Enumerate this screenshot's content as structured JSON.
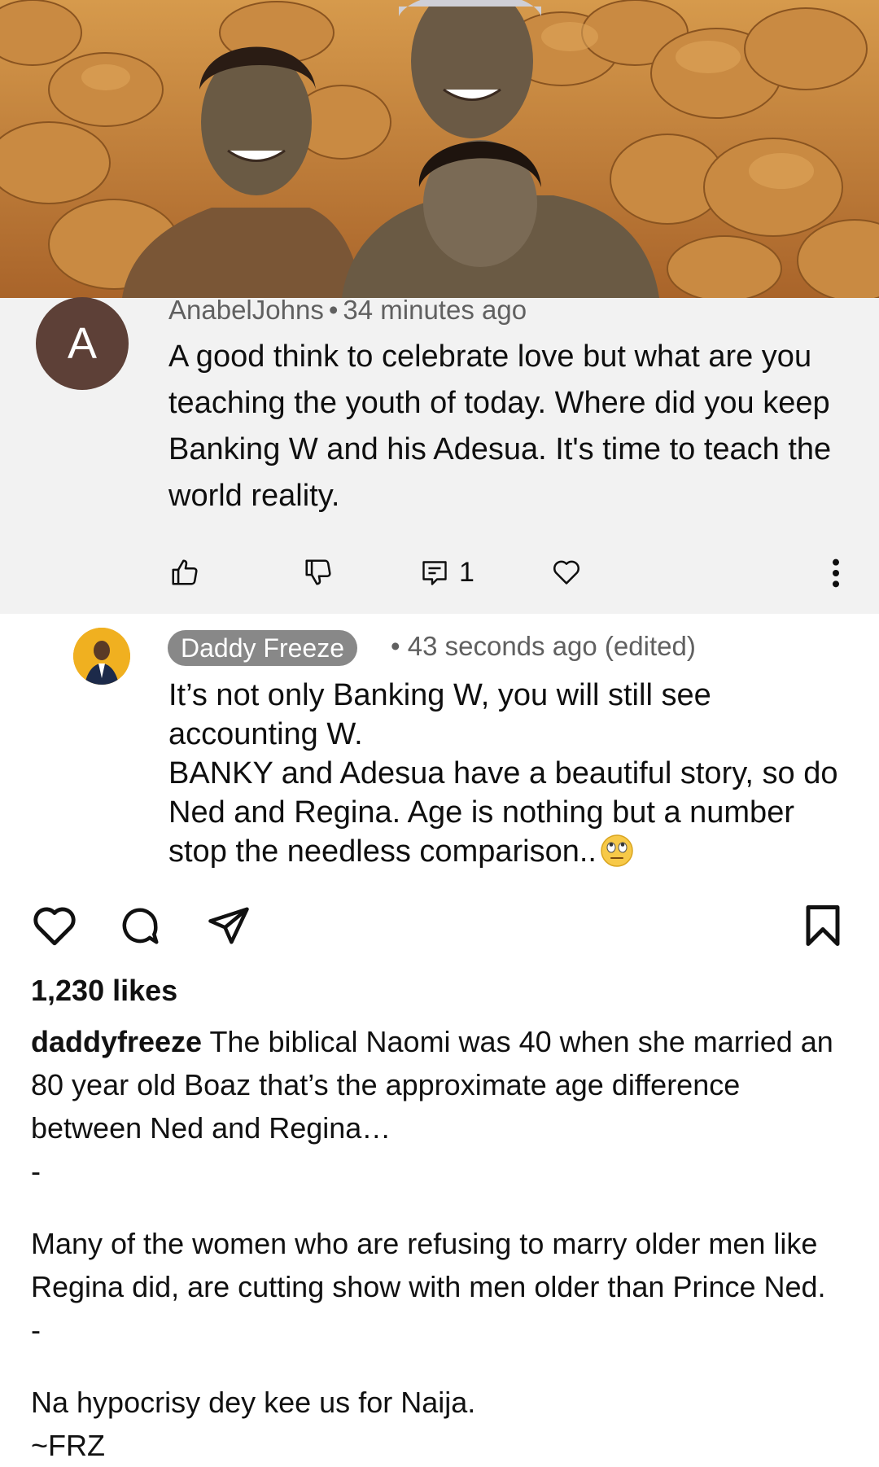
{
  "comment1": {
    "avatar_letter": "A",
    "avatar_color": "#5d4037",
    "author": "AnabelJohns",
    "separator": "•",
    "time": "34 minutes ago",
    "text": "A good think to celebrate love but what are you teaching the youth of today. Where did you keep Banking W and his Adesua. It's time to teach the world reality.",
    "reply_count": "1",
    "icons": [
      "thumbs-up-icon",
      "thumbs-down-icon",
      "reply-icon",
      "heart-icon",
      "more-vert-icon"
    ]
  },
  "comment2": {
    "author": "Daddy Freeze",
    "separator": "•",
    "time": "43 seconds ago (edited)",
    "lines": [
      "It’s not only Banking W, you will still see accounting W.",
      "BANKY and Adesua have a beautiful story, so do Ned and Regina. Age is nothing but a number stop the needless comparison.."
    ],
    "emoji": "eye-roll-emoji"
  },
  "post": {
    "icons": [
      "heart-icon",
      "comment-icon",
      "share-icon",
      "bookmark-icon"
    ],
    "likes": "1,230 likes",
    "caption_user": "daddyfreeze",
    "caption_first": "The biblical Naomi was 40 when she married an 80 year old Boaz that’s the approximate age difference between Ned and Regina…",
    "divider1": "-",
    "paragraph2": "Many of the women who are refusing to marry older men like Regina did, are cutting show with men older than Prince Ned.",
    "divider2": "-",
    "paragraph3": "Na hypocrisy dey kee us for Naija.",
    "signature": "~FRZ"
  },
  "colors": {
    "comment_bg": "#f2f2f2",
    "chip_bg": "#888888",
    "meta_text": "#606060"
  }
}
